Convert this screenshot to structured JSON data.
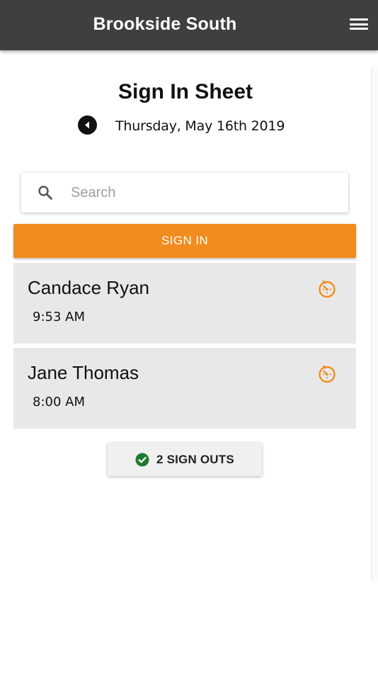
{
  "app": {
    "title": "Brookside South"
  },
  "page": {
    "title": "Sign In Sheet",
    "date": "Thursday, May 16th 2019"
  },
  "search": {
    "placeholder": "Search",
    "value": ""
  },
  "actions": {
    "sign_in_label": "SIGN IN",
    "sign_outs_label": "2 SIGN OUTS"
  },
  "entries": [
    {
      "name": "Candace Ryan",
      "time": "9:53 AM"
    },
    {
      "name": "Jane Thomas",
      "time": "8:00 AM"
    }
  ],
  "colors": {
    "appbar": "#3f3f3f",
    "accent": "#f28c1e",
    "entry_background": "#e8e8e8",
    "success": "#1e7a2e"
  },
  "icons": {
    "menu": "hamburger-menu-icon",
    "back": "back-arrow-icon",
    "search": "search-icon",
    "timer": "timer-icon",
    "check": "check-circle-icon"
  }
}
